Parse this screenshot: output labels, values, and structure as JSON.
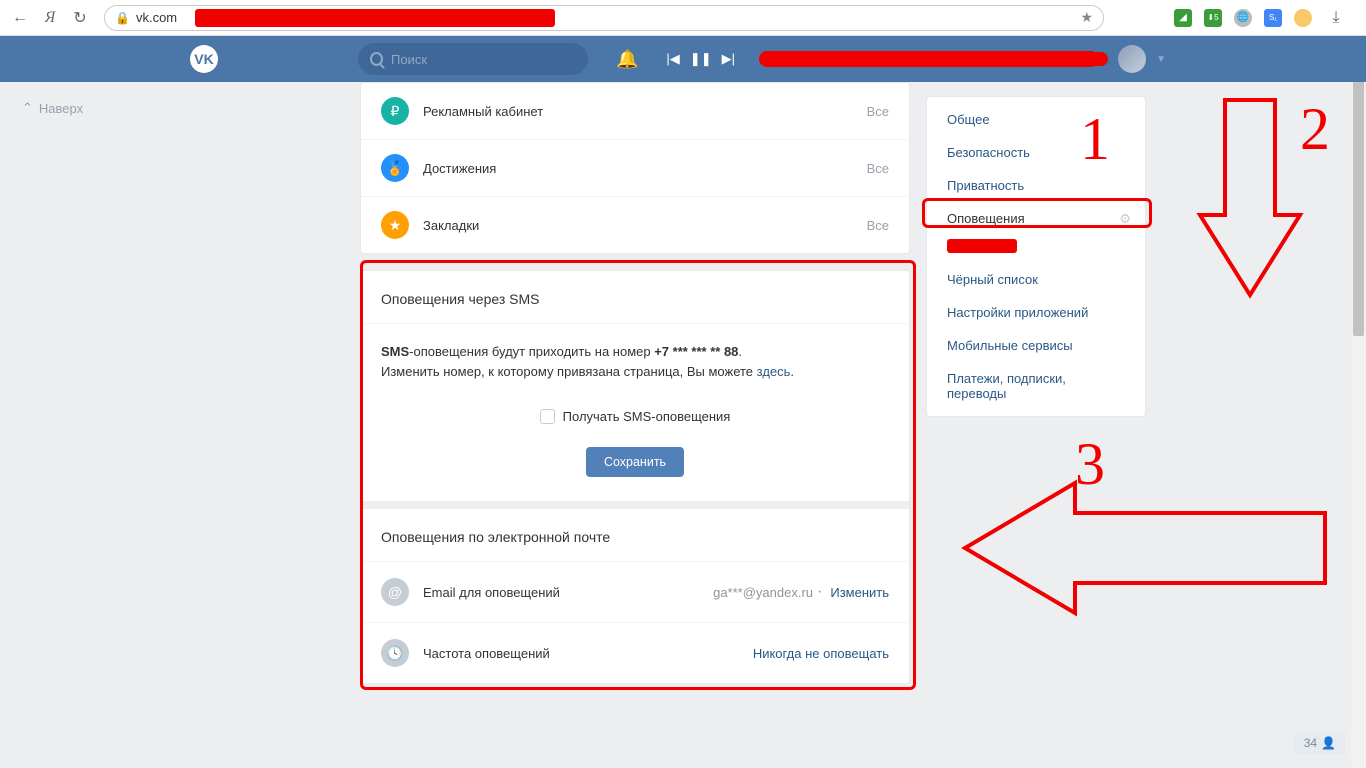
{
  "browser": {
    "url": "vk.com"
  },
  "vk": {
    "search_placeholder": "Поиск"
  },
  "back_top": "Наверх",
  "menu": {
    "items": [
      {
        "label": "Рекламный кабинет",
        "all": "Все"
      },
      {
        "label": "Достижения",
        "all": "Все"
      },
      {
        "label": "Закладки",
        "all": "Все"
      }
    ]
  },
  "sms": {
    "title": "Оповещения через SMS",
    "prefix": "SMS",
    "line1a": "-оповещения будут приходить на номер ",
    "phone": "+7 *** *** ** 88",
    "dot": ".",
    "line2a": "Изменить номер, к которому привязана страница, Вы можете ",
    "here": "здесь",
    "checkbox": "Получать SMS-оповещения",
    "save": "Сохранить"
  },
  "email": {
    "title": "Оповещения по электронной почте",
    "row1_label": "Email для оповещений",
    "row1_value": "ga***@yandex.ru",
    "row1_link": "Изменить",
    "row2_label": "Частота оповещений",
    "row2_link": "Никогда не оповещать"
  },
  "sidebar": {
    "items": [
      "Общее",
      "Безопасность",
      "Приватность",
      "Оповещения",
      "Чёрный список",
      "Настройки приложений",
      "Мобильные сервисы",
      "Платежи, подписки, переводы"
    ]
  },
  "anno": {
    "n1": "1",
    "n2": "2",
    "n3": "3"
  },
  "counter": "34"
}
